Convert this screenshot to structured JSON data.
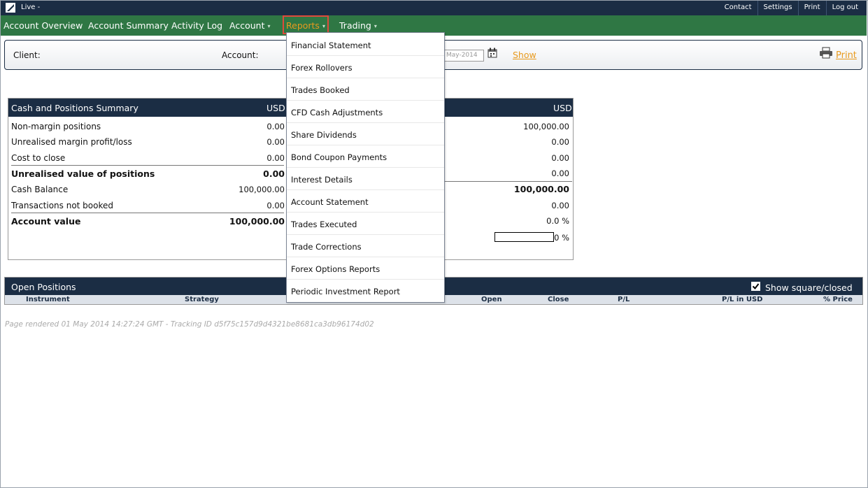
{
  "top": {
    "environment": "Live -",
    "links": [
      "Contact",
      "Settings",
      "Print",
      "Log out"
    ]
  },
  "nav": {
    "items": [
      "Account Overview",
      "Account Summary",
      "Activity Log",
      "Account",
      "Reports",
      "Trading"
    ],
    "dropdown_marker": "¥"
  },
  "client_bar": {
    "client_label": "Client:",
    "account_label": "Account:",
    "date_value": "May-2014",
    "show_label": "Show",
    "print_label": "Print"
  },
  "summary": {
    "title": "Cash and Positions Summary",
    "currency_left": "USD",
    "currency_right": "USD",
    "rows": [
      {
        "label": "Non-margin positions",
        "value": "0.00"
      },
      {
        "label": "Unrealised margin profit/loss",
        "value": "0.00"
      },
      {
        "label": "Cost to close",
        "value": "0.00"
      },
      {
        "label": "Unrealised value of positions",
        "value": "0.00"
      },
      {
        "label": "Cash Balance",
        "value": "100,000.00"
      },
      {
        "label": "Transactions not booked",
        "value": "0.00"
      },
      {
        "label": "Account value",
        "value": "100,000.00"
      }
    ],
    "right_values": [
      "100,000.00",
      "0.00",
      "0.00",
      "0.00",
      "100,000.00",
      "0.00",
      "0.0 %",
      "0 %"
    ],
    "margin_utilisation": 0
  },
  "positions": {
    "title": "Open Positions",
    "show_closed_label": "Show square/closed",
    "show_closed_checked": true,
    "columns": [
      "Instrument",
      "Strategy",
      "Open",
      "Close",
      "P/L",
      "P/L in USD",
      "% Price"
    ]
  },
  "footer": {
    "note": "Page rendered 01 May 2014 14:27:24 GMT - Tracking ID d5f75c157d9d4321be8681ca3db96174d02"
  },
  "reports_menu": {
    "items": [
      "Financial Statement",
      "Forex Rollovers",
      "Trades Booked",
      "CFD Cash Adjustments",
      "Share Dividends",
      "Bond Coupon Payments",
      "Interest Details",
      "Account Statement",
      "Trades Executed",
      "Trade Corrections",
      "Forex Options Reports",
      "Periodic Investment Report"
    ]
  },
  "colors": {
    "header_navy": "#1b2d44",
    "nav_green": "#2f7744",
    "accent_orange": "#e89a1e",
    "highlight_red": "#e04a3b"
  }
}
